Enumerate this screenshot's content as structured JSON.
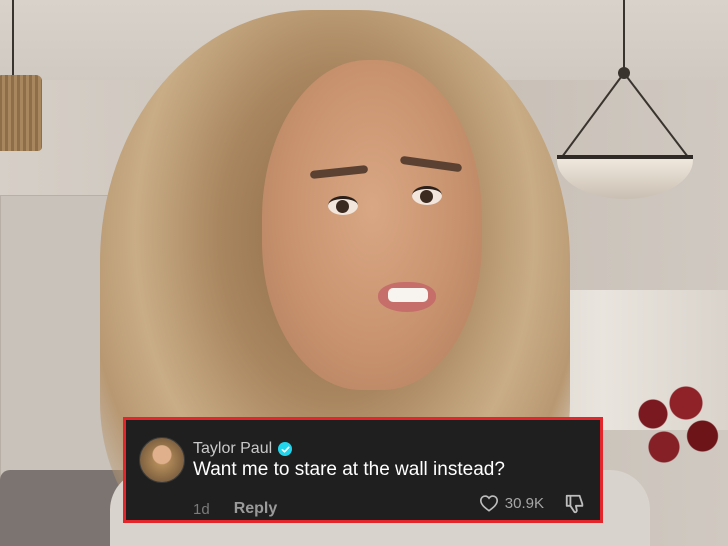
{
  "comment": {
    "username": "Taylor Paul",
    "verified": true,
    "text": "Want me to stare at the wall instead?",
    "timestamp": "1d",
    "reply_label": "Reply",
    "like_count": "30.9K"
  },
  "icons": {
    "verified": "verified-badge-icon",
    "like": "heart-icon",
    "dislike": "thumbs-down-icon"
  },
  "colors": {
    "card_background": "#1f1f1f",
    "card_border": "#e2262b",
    "verified_badge": "#20d5ec"
  }
}
